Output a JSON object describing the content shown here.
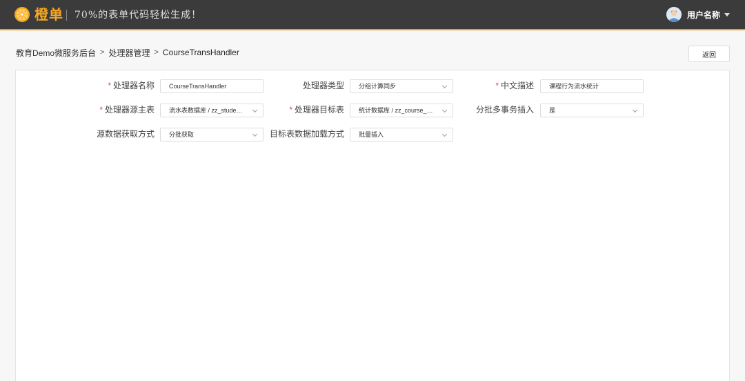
{
  "app": {
    "name": "橙单",
    "slogan": "70%的表单代码轻松生成！",
    "logo_icon": "orange-slice-icon",
    "accent_color": "#f5a623",
    "topbar_color": "#3b3b3b"
  },
  "user": {
    "name": "用户名称",
    "avatar_icon": "avatar-icon",
    "menu_icon": "caret-down-icon"
  },
  "breadcrumb": {
    "items": [
      "教育Demo微服务后台",
      "处理器管理",
      "CourseTransHandler"
    ],
    "separator": ">"
  },
  "actions": {
    "back_label": "返回"
  },
  "form": {
    "required_color": "#e2483d",
    "handler_name": {
      "label": "处理器名称",
      "required": "*",
      "value": "CourseTransHandler"
    },
    "handler_type": {
      "label": "处理器类型",
      "value": "分组计算同步"
    },
    "description": {
      "label": "中文描述",
      "required": "*",
      "value": "课程行为流水统计"
    },
    "source_table": {
      "label": "处理器源主表",
      "required": "*",
      "value": "流水表数据库 / zz_student_action_trans"
    },
    "target_table": {
      "label": "处理器目标表",
      "required": "*",
      "value": "统计数据库 / zz_course_trans_stats"
    },
    "batch_tx_insert": {
      "label": "分批多事务插入",
      "value": "是"
    },
    "source_fetch": {
      "label": "源数据获取方式",
      "value": "分批获取"
    },
    "target_load": {
      "label": "目标表数据加载方式",
      "value": "批量插入"
    }
  }
}
